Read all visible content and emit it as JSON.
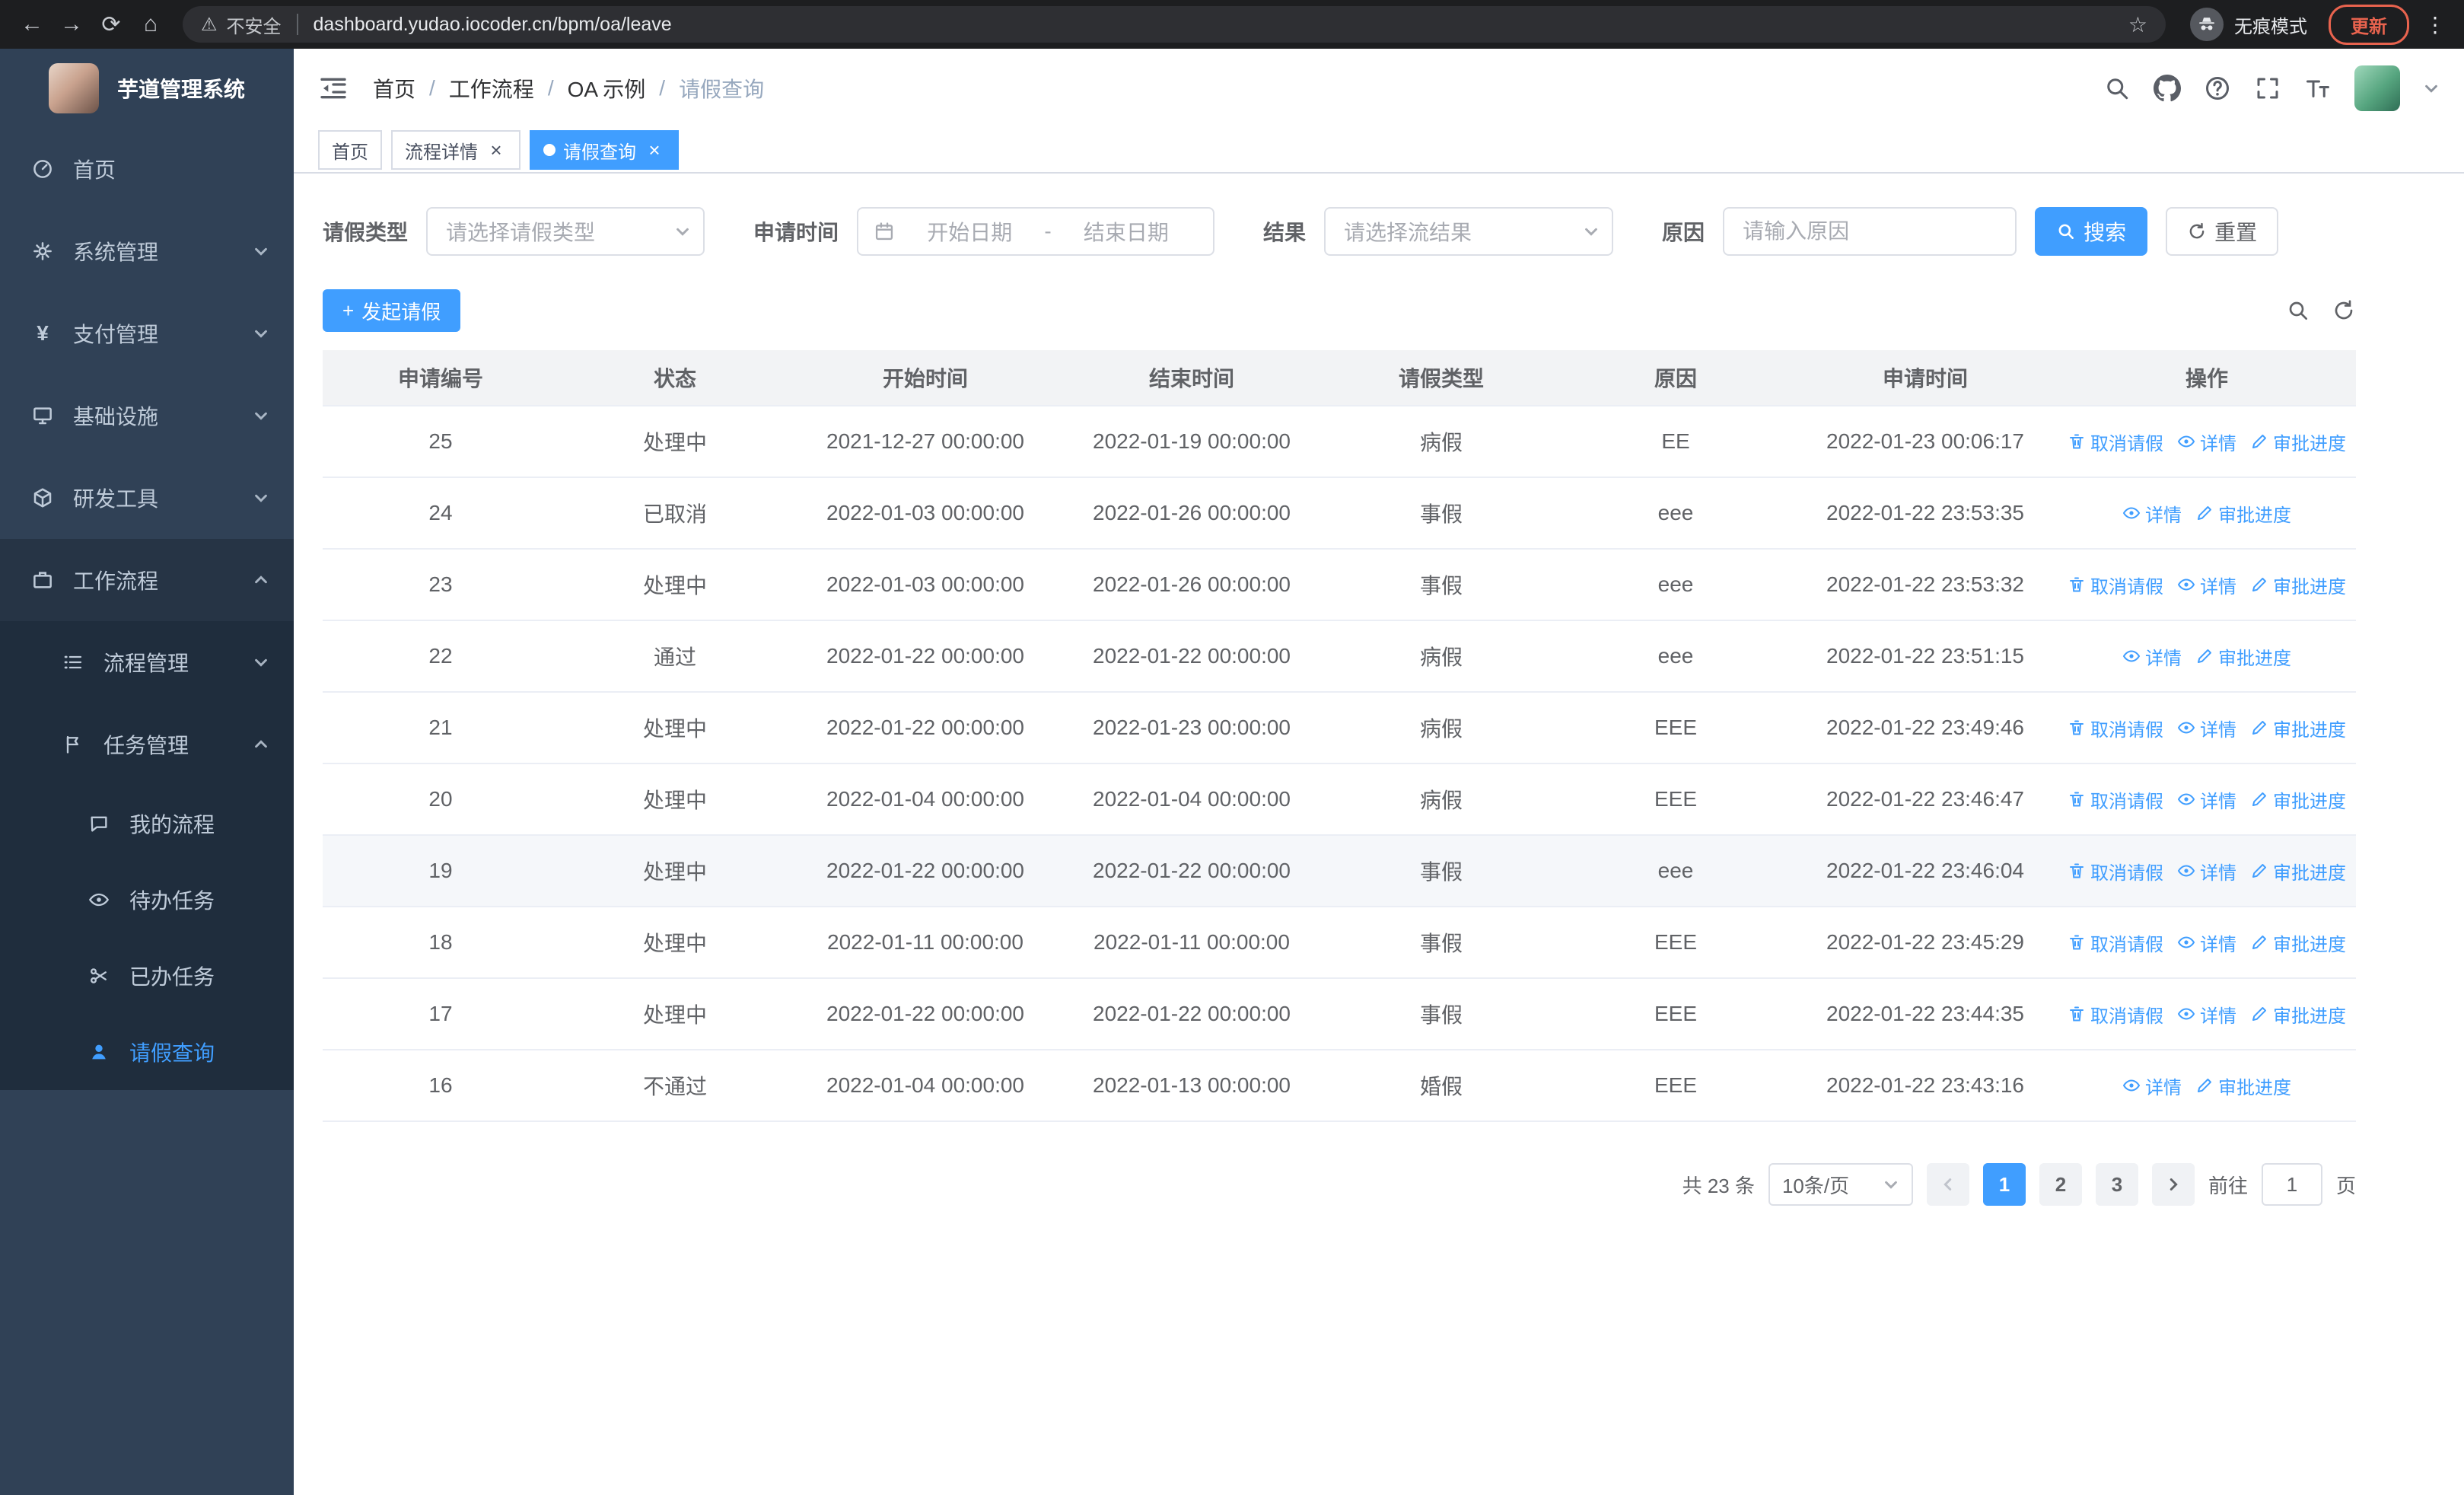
{
  "browser": {
    "url": "dashboard.yudao.iocoder.cn/bpm/oa/leave",
    "security_label": "不安全",
    "incognito_label": "无痕模式",
    "update_label": "更新"
  },
  "icons": {
    "back": "←",
    "forward": "→",
    "reload": "⟳",
    "home": "⌂",
    "warning": "⚠",
    "star": "☆",
    "menu_dots": "⋮",
    "yen": "¥",
    "plus": "+",
    "close": "×"
  },
  "sidebar": {
    "title": "芋道管理系统",
    "home": "首页",
    "system": "系统管理",
    "payment": "支付管理",
    "infra": "基础设施",
    "devtools": "研发工具",
    "workflow": "工作流程",
    "process_mgmt": "流程管理",
    "task_mgmt": "任务管理",
    "my_process": "我的流程",
    "todo_tasks": "待办任务",
    "done_tasks": "已办任务",
    "leave_query": "请假查询"
  },
  "header": {
    "breadcrumb": [
      "首页",
      "工作流程",
      "OA 示例",
      "请假查询"
    ],
    "separator": "/"
  },
  "tabs": [
    {
      "label": "首页"
    },
    {
      "label": "流程详情"
    },
    {
      "label": "请假查询"
    }
  ],
  "filters": {
    "leave_type_label": "请假类型",
    "leave_type_placeholder": "请选择请假类型",
    "apply_time_label": "申请时间",
    "start_placeholder": "开始日期",
    "range_separator": "-",
    "end_placeholder": "结束日期",
    "result_label": "结果",
    "result_placeholder": "请选择流结果",
    "reason_label": "原因",
    "reason_placeholder": "请输入原因",
    "search_label": "搜索",
    "reset_label": "重置"
  },
  "toolbar": {
    "create_label": "发起请假"
  },
  "table": {
    "columns": [
      "申请编号",
      "状态",
      "开始时间",
      "结束时间",
      "请假类型",
      "原因",
      "申请时间",
      "操作"
    ],
    "action_labels": {
      "cancel": "取消请假",
      "detail": "详情",
      "progress": "审批进度"
    },
    "rows": [
      {
        "id": "25",
        "status": "处理中",
        "start": "2021-12-27 00:00:00",
        "end": "2022-01-19 00:00:00",
        "type": "病假",
        "reason": "EE",
        "applied": "2022-01-23 00:06:17",
        "cancellable": true,
        "hover": false
      },
      {
        "id": "24",
        "status": "已取消",
        "start": "2022-01-03 00:00:00",
        "end": "2022-01-26 00:00:00",
        "type": "事假",
        "reason": "eee",
        "applied": "2022-01-22 23:53:35",
        "cancellable": false,
        "hover": false
      },
      {
        "id": "23",
        "status": "处理中",
        "start": "2022-01-03 00:00:00",
        "end": "2022-01-26 00:00:00",
        "type": "事假",
        "reason": "eee",
        "applied": "2022-01-22 23:53:32",
        "cancellable": true,
        "hover": false
      },
      {
        "id": "22",
        "status": "通过",
        "start": "2022-01-22 00:00:00",
        "end": "2022-01-22 00:00:00",
        "type": "病假",
        "reason": "eee",
        "applied": "2022-01-22 23:51:15",
        "cancellable": false,
        "hover": false
      },
      {
        "id": "21",
        "status": "处理中",
        "start": "2022-01-22 00:00:00",
        "end": "2022-01-23 00:00:00",
        "type": "病假",
        "reason": "EEE",
        "applied": "2022-01-22 23:49:46",
        "cancellable": true,
        "hover": false
      },
      {
        "id": "20",
        "status": "处理中",
        "start": "2022-01-04 00:00:00",
        "end": "2022-01-04 00:00:00",
        "type": "病假",
        "reason": "EEE",
        "applied": "2022-01-22 23:46:47",
        "cancellable": true,
        "hover": false
      },
      {
        "id": "19",
        "status": "处理中",
        "start": "2022-01-22 00:00:00",
        "end": "2022-01-22 00:00:00",
        "type": "事假",
        "reason": "eee",
        "applied": "2022-01-22 23:46:04",
        "cancellable": true,
        "hover": true
      },
      {
        "id": "18",
        "status": "处理中",
        "start": "2022-01-11 00:00:00",
        "end": "2022-01-11 00:00:00",
        "type": "事假",
        "reason": "EEE",
        "applied": "2022-01-22 23:45:29",
        "cancellable": true,
        "hover": false
      },
      {
        "id": "17",
        "status": "处理中",
        "start": "2022-01-22 00:00:00",
        "end": "2022-01-22 00:00:00",
        "type": "事假",
        "reason": "EEE",
        "applied": "2022-01-22 23:44:35",
        "cancellable": true,
        "hover": false
      },
      {
        "id": "16",
        "status": "不通过",
        "start": "2022-01-04 00:00:00",
        "end": "2022-01-13 00:00:00",
        "type": "婚假",
        "reason": "EEE",
        "applied": "2022-01-22 23:43:16",
        "cancellable": false,
        "hover": false
      }
    ]
  },
  "pagination": {
    "total_label": "共 23 条",
    "page_size": "10条/页",
    "pages": [
      "1",
      "2",
      "3"
    ],
    "active_page": "1",
    "goto_label": "前往",
    "goto_value": "1",
    "page_unit": "页"
  },
  "colors": {
    "primary": "#409eff",
    "sidebar_bg": "#304156",
    "submenu_bg": "#1f2d3d",
    "update_accent": "#e8634e"
  }
}
